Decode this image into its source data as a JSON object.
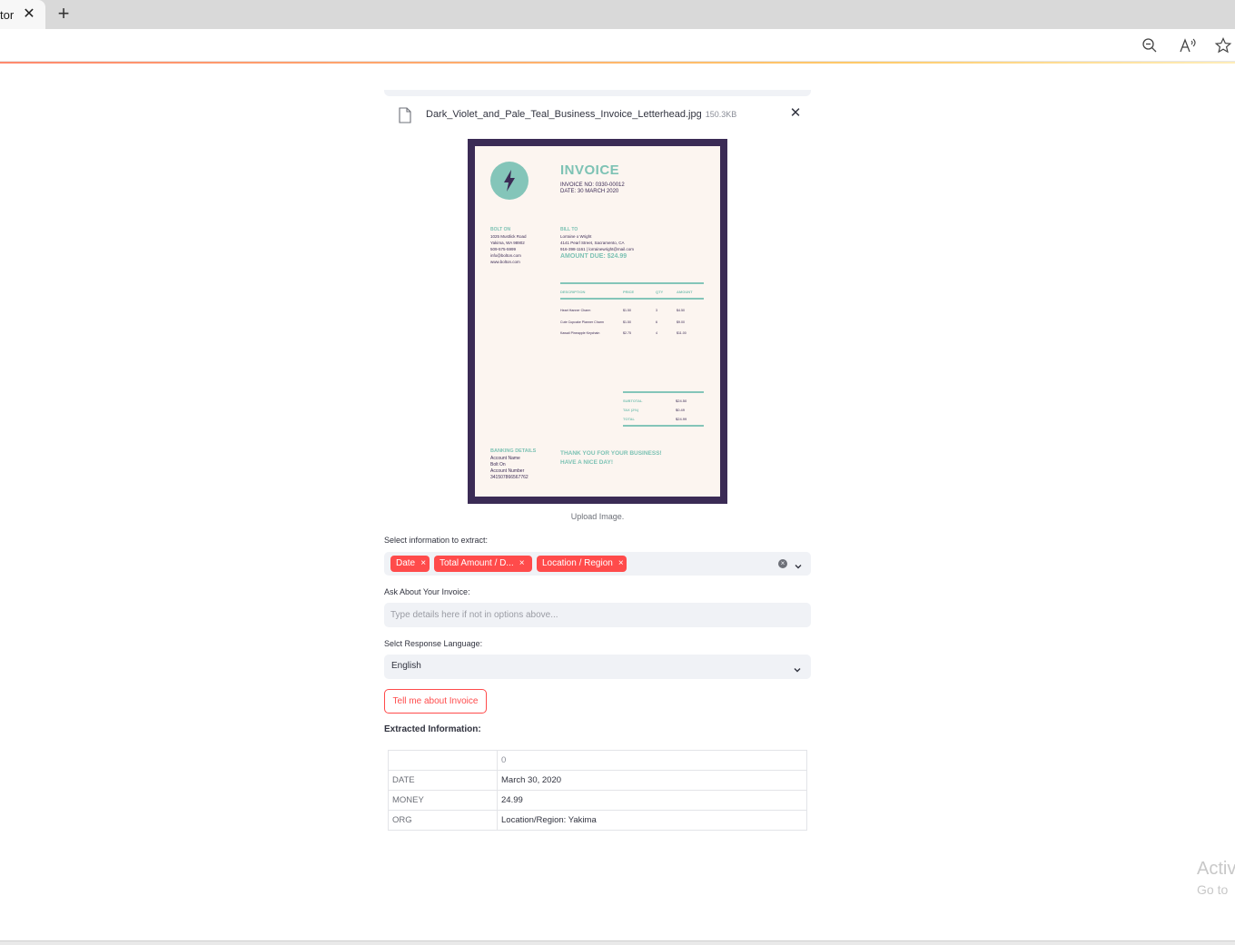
{
  "browser": {
    "tab_title": "tor",
    "tab_close": "✕",
    "new_tab": "+"
  },
  "uploader": {
    "file_name": "Dark_Violet_and_Pale_Teal_Business_Invoice_Letterhead.jpg",
    "file_size": "150.3KB",
    "remove": "✕",
    "caption": "Upload Image."
  },
  "invoice_image": {
    "title": "INVOICE",
    "invoice_no": "INVOICE NO: 0330-00012",
    "date": "DATE:  30 MARCH 2020",
    "from_heading": "BOLT ON",
    "from_lines": "1025 Mustlick Road\nYakima, WA 98902\n509-575-5999\ninfo@bolton.com\nwww.bolton.com",
    "bill_heading": "BILL TO",
    "bill_lines": "Lorraine o Wright\n4141 Pearl Street, Sacramento, CA\n916-398-1161 | lorrainewright@mail.com",
    "amount_due": "AMOUNT DUE: $24.99",
    "columns": [
      "DESCRIPTION",
      "PRICE",
      "QTY",
      "AMOUNT"
    ],
    "rows": [
      [
        "Heart Hanner Charm",
        "$1.50",
        "3",
        "$4.50"
      ],
      [
        "Cute Cupcake Planner Charm",
        "$1.50",
        "6",
        "$9.00"
      ],
      [
        "Kawaii Pineapple Keychain",
        "$2.75",
        "4",
        "$11.00"
      ]
    ],
    "totals": [
      [
        "SUBTOTAL",
        "$24.50"
      ],
      [
        "TAX (2%)",
        "$0.49"
      ],
      [
        "TOTAL",
        "$24.99"
      ]
    ],
    "banking_heading": "BANKING DETAILS",
    "banking_lines": "Account Name\nBolt On\nAccount Number\n341507866567762",
    "thanks": "THANK YOU FOR YOUR BUSINESS!\nHAVE A NICE DAY!"
  },
  "extract": {
    "label": "Select information to extract:",
    "chips": [
      "Date",
      "Total Amount / D...",
      "Location / Region"
    ],
    "chip_remove": "×"
  },
  "ask": {
    "label": "Ask About Your Invoice:",
    "placeholder": "Type details here if not in options above..."
  },
  "language": {
    "label": "Selct Response Language:",
    "value": "English"
  },
  "submit_button": "Tell me about Invoice",
  "results": {
    "heading": "Extracted Information:",
    "column_header": "0",
    "rows": [
      {
        "key": "DATE",
        "value": "March 30, 2020"
      },
      {
        "key": "MONEY",
        "value": "24.99"
      },
      {
        "key": "ORG",
        "value": "Location/Region: Yakima"
      }
    ]
  },
  "watermark": {
    "line1": "Activ",
    "line2": "Go to"
  }
}
